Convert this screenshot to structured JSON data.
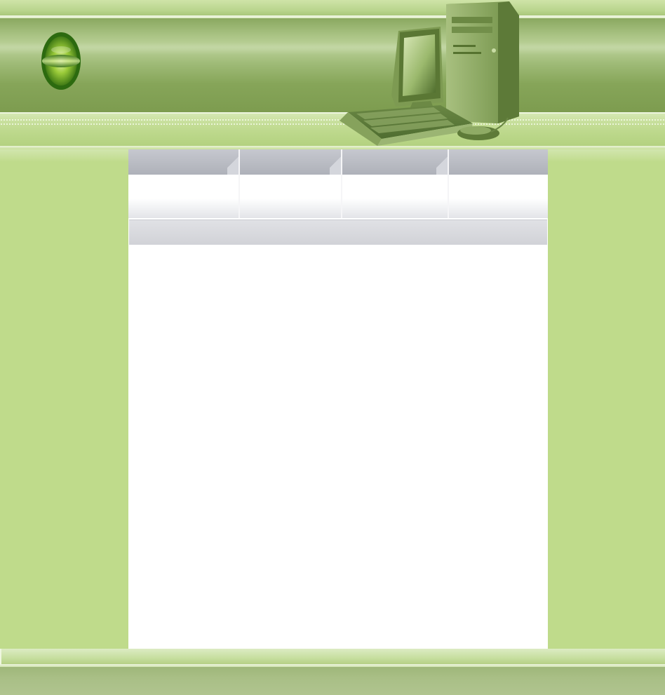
{
  "page": {
    "title": "",
    "theme_colors": {
      "page_background": "#bfdb8b",
      "banner": "#8aa860",
      "tab": "#b4b7bf",
      "content": "#ffffff",
      "footer": "#a9bf86"
    }
  },
  "header": {
    "logo": {
      "icon": "green-oval-logo-icon"
    },
    "illustration": {
      "icon": "desktop-computer-icon",
      "parts": [
        "monitor",
        "tower",
        "keyboard",
        "mouse"
      ]
    }
  },
  "nav": {
    "tabs": [
      {
        "label": ""
      },
      {
        "label": ""
      },
      {
        "label": ""
      },
      {
        "label": ""
      }
    ]
  },
  "content": {
    "section_header": "",
    "body": ""
  },
  "footer": {
    "text": ""
  }
}
